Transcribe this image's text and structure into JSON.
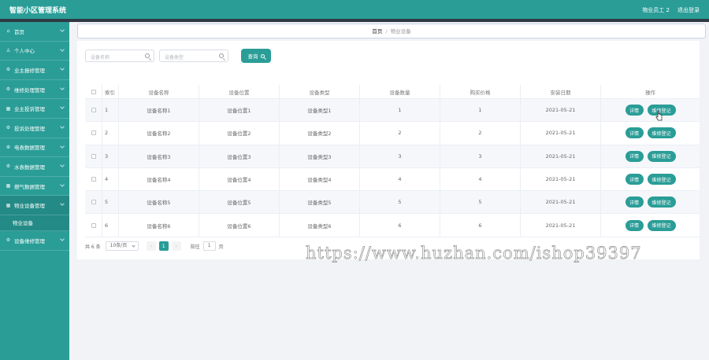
{
  "header": {
    "app_title": "智能小区管理系统",
    "user_label": "物业员工 2",
    "logout_label": "退出登录"
  },
  "sidebar": {
    "items": [
      {
        "label": "首页",
        "icon": "home-icon"
      },
      {
        "label": "个人中心",
        "icon": "user-icon"
      },
      {
        "label": "业主报修管理",
        "icon": "gear-icon"
      },
      {
        "label": "维修处理管理",
        "icon": "gear-icon"
      },
      {
        "label": "业主投诉管理",
        "icon": "grid-icon"
      },
      {
        "label": "投诉处理管理",
        "icon": "gear-icon"
      },
      {
        "label": "电表数据管理",
        "icon": "gear-icon"
      },
      {
        "label": "水表数据管理",
        "icon": "gear-icon"
      },
      {
        "label": "燃气数据管理",
        "icon": "grid-icon"
      },
      {
        "label": "物业设备管理",
        "icon": "grid-icon"
      }
    ],
    "sub_item": "物业设备",
    "last_item": {
      "label": "设备维修管理",
      "icon": "gear-icon"
    }
  },
  "breadcrumb": {
    "home": "首页",
    "separator": "/",
    "current": "物业设备"
  },
  "search": {
    "name_placeholder": "设备名称",
    "type_placeholder": "设备类型",
    "query_label": "查询"
  },
  "table": {
    "headers": [
      "索引",
      "设备名称",
      "设备位置",
      "设备类型",
      "设备数量",
      "购买价格",
      "安装日期",
      "操作"
    ],
    "rows": [
      [
        "1",
        "设备名称1",
        "设备位置1",
        "设备类型1",
        "1",
        "1",
        "2021-05-21"
      ],
      [
        "2",
        "设备名称2",
        "设备位置2",
        "设备类型2",
        "2",
        "2",
        "2021-05-21"
      ],
      [
        "3",
        "设备名称3",
        "设备位置3",
        "设备类型3",
        "3",
        "3",
        "2021-05-21"
      ],
      [
        "4",
        "设备名称4",
        "设备位置4",
        "设备类型4",
        "4",
        "4",
        "2021-05-21"
      ],
      [
        "5",
        "设备名称5",
        "设备位置5",
        "设备类型5",
        "5",
        "5",
        "2021-05-21"
      ],
      [
        "6",
        "设备名称6",
        "设备位置6",
        "设备类型6",
        "6",
        "6",
        "2021-05-21"
      ]
    ],
    "detail_label": "详情",
    "repair_label": "维修登记"
  },
  "pager": {
    "total": "共 6 条",
    "page_size": "10条/页",
    "prev": "‹",
    "current_page": "1",
    "next": "›",
    "goto_label": "前往",
    "goto_value": "1",
    "page_suffix": "页"
  },
  "watermark": "https://www.huzhan.com/ishop39397",
  "colors": {
    "primary": "#2a9d97",
    "header_strip": "#2f3a44",
    "page_bg": "#f2f3f7"
  }
}
